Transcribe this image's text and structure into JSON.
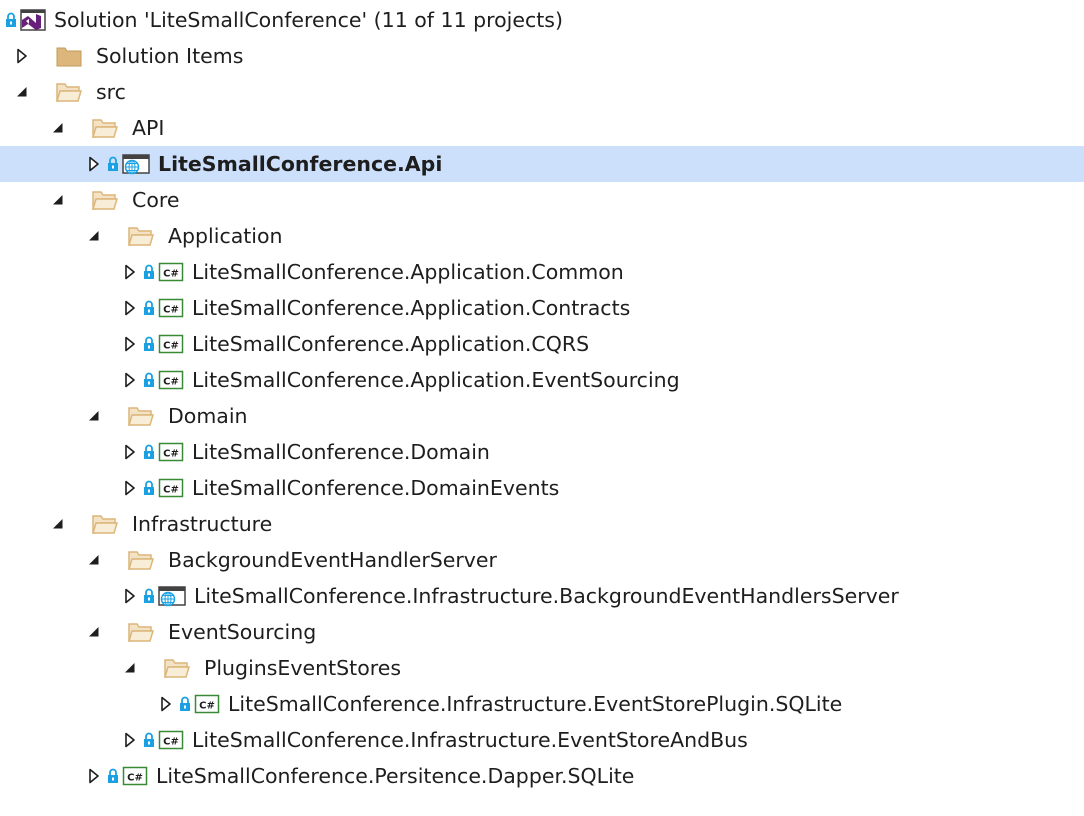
{
  "solution_explorer": {
    "rows": [
      {
        "label": "Solution 'LiteSmallConference' (11 of 11 projects)",
        "icon": "solution-icon",
        "expander": "none",
        "lock": true,
        "indent": 0
      },
      {
        "label": "Solution Items",
        "icon": "folder-icon",
        "expander": "collapsed",
        "lock": false,
        "indent": 0
      },
      {
        "label": "src",
        "icon": "folder-open-icon",
        "expander": "expanded",
        "lock": false,
        "indent": 0
      },
      {
        "label": "API",
        "icon": "folder-open-icon",
        "expander": "expanded",
        "lock": false,
        "indent": 1
      },
      {
        "label": "LiteSmallConference.Api",
        "icon": "web-project-icon",
        "expander": "collapsed",
        "lock": true,
        "indent": 2,
        "selected": true,
        "bold": true
      },
      {
        "label": "Core",
        "icon": "folder-open-icon",
        "expander": "expanded",
        "lock": false,
        "indent": 1
      },
      {
        "label": "Application",
        "icon": "folder-open-icon",
        "expander": "expanded",
        "lock": false,
        "indent": 2
      },
      {
        "label": "LiteSmallConference.Application.Common",
        "icon": "csharp-project-icon",
        "expander": "collapsed",
        "lock": true,
        "indent": 3
      },
      {
        "label": "LiteSmallConference.Application.Contracts",
        "icon": "csharp-project-icon",
        "expander": "collapsed",
        "lock": true,
        "indent": 3
      },
      {
        "label": "LiteSmallConference.Application.CQRS",
        "icon": "csharp-project-icon",
        "expander": "collapsed",
        "lock": true,
        "indent": 3
      },
      {
        "label": "LiteSmallConference.Application.EventSourcing",
        "icon": "csharp-project-icon",
        "expander": "collapsed",
        "lock": true,
        "indent": 3
      },
      {
        "label": "Domain",
        "icon": "folder-open-icon",
        "expander": "expanded",
        "lock": false,
        "indent": 2
      },
      {
        "label": "LiteSmallConference.Domain",
        "icon": "csharp-project-icon",
        "expander": "collapsed",
        "lock": true,
        "indent": 3
      },
      {
        "label": "LiteSmallConference.DomainEvents",
        "icon": "csharp-project-icon",
        "expander": "collapsed",
        "lock": true,
        "indent": 3
      },
      {
        "label": "Infrastructure",
        "icon": "folder-open-icon",
        "expander": "expanded",
        "lock": false,
        "indent": 1
      },
      {
        "label": "BackgroundEventHandlerServer",
        "icon": "folder-open-icon",
        "expander": "expanded",
        "lock": false,
        "indent": 2
      },
      {
        "label": "LiteSmallConference.Infrastructure.BackgroundEventHandlersServer",
        "icon": "web-project-icon",
        "expander": "collapsed",
        "lock": true,
        "indent": 3
      },
      {
        "label": "EventSourcing",
        "icon": "folder-open-icon",
        "expander": "expanded",
        "lock": false,
        "indent": 2
      },
      {
        "label": "PluginsEventStores",
        "icon": "folder-open-icon",
        "expander": "expanded",
        "lock": false,
        "indent": 3
      },
      {
        "label": "LiteSmallConference.Infrastructure.EventStorePlugin.SQLite",
        "icon": "csharp-project-icon",
        "expander": "collapsed",
        "lock": true,
        "indent": 4
      },
      {
        "label": "LiteSmallConference.Infrastructure.EventStoreAndBus",
        "icon": "csharp-project-icon",
        "expander": "collapsed",
        "lock": true,
        "indent": 3
      },
      {
        "label": "LiteSmallConference.Persitence.Dapper.SQLite",
        "icon": "csharp-project-icon",
        "expander": "collapsed",
        "lock": true,
        "indent": 2
      }
    ],
    "csharp_badge": "C#",
    "colors": {
      "selection": "#cce0fb",
      "folder": "#dcb67a",
      "csharp": "#388a34",
      "lock": "#1ba1e2",
      "solution": "#68217a"
    }
  }
}
